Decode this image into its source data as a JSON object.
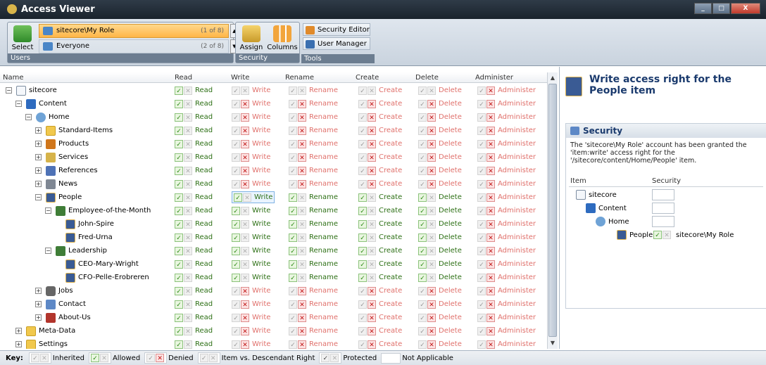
{
  "window": {
    "title": "Access Viewer",
    "buttons": [
      "_",
      "□",
      "X"
    ]
  },
  "ribbon": {
    "users_group": {
      "caption": "Users",
      "select_label": "Select",
      "items": [
        {
          "name": "sitecore\\My Role",
          "count": "(1 of 8)"
        },
        {
          "name": "Everyone",
          "count": "(2 of 8)"
        }
      ]
    },
    "security_group": {
      "caption": "Security",
      "assign_label": "Assign",
      "columns_label": "Columns"
    },
    "tools_group": {
      "caption": "Tools",
      "security_editor": "Security Editor",
      "user_manager": "User Manager"
    }
  },
  "grid": {
    "headers": [
      "Name",
      "Read",
      "Write",
      "Rename",
      "Create",
      "Delete",
      "Administer"
    ],
    "rows": [
      {
        "name": "sitecore",
        "icon": "page-icon",
        "expander": "−",
        "rights": [
          "A",
          "I",
          "I",
          "I",
          "I",
          "D"
        ]
      },
      {
        "name": "Content",
        "icon": "content-icon",
        "expander": "−",
        "rights": [
          "A",
          "D",
          "D",
          "D",
          "D",
          "D"
        ]
      },
      {
        "name": "Home",
        "icon": "home-icon",
        "expander": "−",
        "rights": [
          "A",
          "D",
          "D",
          "D",
          "D",
          "D"
        ]
      },
      {
        "name": "Standard-Items",
        "icon": "folder-icon",
        "expander": "+",
        "rights": [
          "A",
          "D",
          "D",
          "D",
          "D",
          "D"
        ]
      },
      {
        "name": "Products",
        "icon": "products-icon",
        "expander": "+",
        "rights": [
          "A",
          "D",
          "D",
          "D",
          "D",
          "D"
        ]
      },
      {
        "name": "Services",
        "icon": "services-icon",
        "expander": "+",
        "rights": [
          "A",
          "D",
          "D",
          "D",
          "D",
          "D"
        ]
      },
      {
        "name": "References",
        "icon": "references-icon",
        "expander": "+",
        "rights": [
          "A",
          "D",
          "D",
          "D",
          "D",
          "D"
        ]
      },
      {
        "name": "News",
        "icon": "news-icon",
        "expander": "+",
        "rights": [
          "A",
          "D",
          "D",
          "D",
          "D",
          "D"
        ]
      },
      {
        "name": "People",
        "icon": "person-icon",
        "expander": "−",
        "rights": [
          "A",
          "A",
          "A",
          "A",
          "A",
          "D"
        ]
      },
      {
        "name": "Employee-of-the-Month",
        "icon": "group-icon",
        "expander": "−",
        "rights": [
          "A",
          "A",
          "A",
          "A",
          "A",
          "D"
        ]
      },
      {
        "name": "John-Spire",
        "icon": "person-icon",
        "expander": "",
        "rights": [
          "A",
          "A",
          "A",
          "A",
          "A",
          "D"
        ]
      },
      {
        "name": "Fred-Urna",
        "icon": "person-icon",
        "expander": "",
        "rights": [
          "A",
          "A",
          "A",
          "A",
          "A",
          "D"
        ]
      },
      {
        "name": "Leadership",
        "icon": "group-icon",
        "expander": "−",
        "rights": [
          "A",
          "A",
          "A",
          "A",
          "A",
          "D"
        ]
      },
      {
        "name": "CEO-Mary-Wright",
        "icon": "person-icon",
        "expander": "",
        "rights": [
          "A",
          "A",
          "A",
          "A",
          "A",
          "D"
        ]
      },
      {
        "name": "CFO-Pelle-Erobreren",
        "icon": "person-icon",
        "expander": "",
        "rights": [
          "A",
          "A",
          "A",
          "A",
          "A",
          "D"
        ]
      },
      {
        "name": "Jobs",
        "icon": "jobs-icon",
        "expander": "+",
        "rights": [
          "A",
          "D",
          "D",
          "D",
          "D",
          "D"
        ]
      },
      {
        "name": "Contact",
        "icon": "contact-icon",
        "expander": "+",
        "rights": [
          "A",
          "D",
          "D",
          "D",
          "D",
          "D"
        ]
      },
      {
        "name": "About-Us",
        "icon": "about-icon",
        "expander": "+",
        "rights": [
          "A",
          "D",
          "D",
          "D",
          "D",
          "D"
        ]
      },
      {
        "name": "Meta-Data",
        "icon": "folder-icon",
        "expander": "+",
        "rights": [
          "A",
          "D",
          "D",
          "D",
          "D",
          "D"
        ]
      },
      {
        "name": "Settings",
        "icon": "folder-icon",
        "expander": "+",
        "rights": [
          "A",
          "D",
          "D",
          "D",
          "D",
          "D"
        ]
      }
    ]
  },
  "details": {
    "title": "Write access right for the People item",
    "section_title": "Security",
    "message": "The 'sitecore\\My Role' account has been granted the 'item:write' access right for the '/sitecore/content/Home/People' item.",
    "table_headers": [
      "Item",
      "Security"
    ],
    "table_rows": [
      {
        "item": "sitecore",
        "security": ""
      },
      {
        "item": "Content",
        "security": ""
      },
      {
        "item": "Home",
        "security": ""
      },
      {
        "item": "People",
        "security": "sitecore\\My Role"
      }
    ]
  },
  "key": {
    "label": "Key:",
    "items": [
      "Inherited",
      "Allowed",
      "Denied",
      "Item vs. Descendant Right",
      "Protected",
      "Not Applicable"
    ]
  },
  "colors": {
    "allowed": "#2c8a14",
    "denied": "#c01414",
    "title_blue": "#1a3a6d",
    "selected_user": "#ffb547"
  }
}
